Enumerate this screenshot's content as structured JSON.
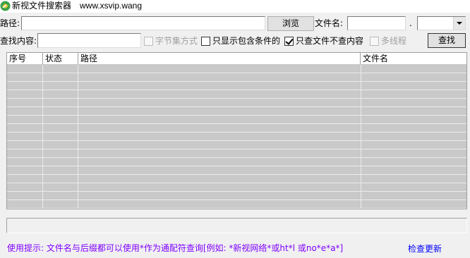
{
  "window": {
    "title": "新视文件搜索器",
    "url": "www.xsvip.wang",
    "icon": "app-logo-icon"
  },
  "toolbar": {
    "path_label": "路径:",
    "path_value": "",
    "browse_label": "浏览",
    "filename_label": "文件名:",
    "filename_value": "",
    "dot": ".",
    "ext_value": ""
  },
  "search": {
    "content_label": "查找内容:",
    "content_value": "",
    "search_label": "查找",
    "options": [
      {
        "label": "字节集方式",
        "checked": false,
        "enabled": false
      },
      {
        "label": "只显示包含条件的",
        "checked": false,
        "enabled": true
      },
      {
        "label": "只查文件不查内容",
        "checked": true,
        "enabled": true
      },
      {
        "label": "多线程",
        "checked": false,
        "enabled": false
      }
    ]
  },
  "results": {
    "columns": [
      "序号",
      "状态",
      "路径",
      "文件名"
    ],
    "rows": []
  },
  "status": {
    "text": ""
  },
  "footer": {
    "hint": "使用提示: 文件名与后缀都可以使用*作为通配符查询[例如: *新视网络*或ht*l 或no*e*a*]",
    "update_link": "检查更新"
  },
  "colors": {
    "hint": "#8000ff",
    "link": "#0000ff",
    "grid_bg": "#c9c9c9",
    "window_bg": "#f0f0f0"
  }
}
